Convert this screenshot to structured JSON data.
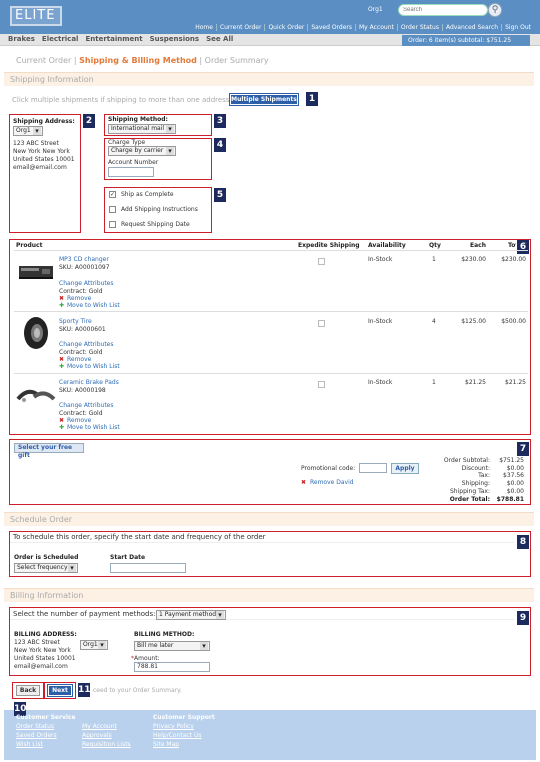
{
  "header": {
    "logo": "ELITE",
    "org": "Org1",
    "search_placeholder": "Search",
    "links": [
      "Home",
      "Current Order",
      "Quick Order",
      "Saved Orders",
      "My Account",
      "Order Status",
      "Advanced Search",
      "Sign Out"
    ],
    "categories": [
      "Brakes",
      "Electrical",
      "Entertainment",
      "Suspensions",
      "See All"
    ],
    "order_summary": "Order: 6 item(s) subtotal: $751.25"
  },
  "steps": [
    "Current Order",
    "Shipping & Billing Method",
    "Order Summary"
  ],
  "shipping": {
    "section_title": "Shipping Information",
    "hint": "Click multiple shipments if shipping to more than one address",
    "multiple_button": "Multiple Shipments",
    "address_label": "Shipping Address:",
    "address_select": "Org1",
    "address_lines": [
      "123 ABC Street",
      "New York New York",
      "United States 10001",
      "email@email.com"
    ],
    "method_label": "Shipping Method:",
    "method_value": "International mail",
    "charge_type_label": "Charge Type",
    "charge_type_value": "Charge by carrier",
    "account_number_label": "Account Number",
    "options": [
      "Ship as Complete",
      "Add Shipping Instructions",
      "Request Shipping Date"
    ]
  },
  "items": {
    "headers": [
      "Product",
      "Expedite Shipping",
      "Availability",
      "Qty",
      "Each",
      "Total"
    ],
    "rows": [
      {
        "name": "MP3 CD changer",
        "sku": "SKU:  A00001097",
        "change": "Change Attributes",
        "contract": "Contract: Gold",
        "remove": "Remove",
        "wish": "Move to Wish List",
        "availability": "In-Stock",
        "qty": "1",
        "each": "$230.00",
        "total": "$230.00"
      },
      {
        "name": "Sporty Tire",
        "sku": "SKU:  A0000601",
        "change": "Change Attributes",
        "contract": "Contract: Gold",
        "remove": "Remove",
        "wish": "Move to Wish List",
        "availability": "In-Stock",
        "qty": "4",
        "each": "$125.00",
        "total": "$500.00"
      },
      {
        "name": "Ceramic Brake Pads",
        "sku": "SKU:  A0000198",
        "change": "Change Attributes",
        "contract": "Contract: Gold",
        "remove": "Remove",
        "wish": "Move to Wish List",
        "availability": "In-Stock",
        "qty": "1",
        "each": "$21.25",
        "total": "$21.25"
      }
    ]
  },
  "totals": {
    "gift_button": "Select your free gift",
    "promo_label": "Promotional code:",
    "apply": "Apply",
    "remove_promo": "Remove David",
    "labels": [
      "Order Subtotal:",
      "Discount:",
      "Tax:",
      "Shipping:",
      "Shipping Tax:",
      "Order Total:"
    ],
    "values": [
      "$751.25",
      "$0.00",
      "$37.56",
      "$0.00",
      "$0.00",
      "$788.81"
    ]
  },
  "schedule": {
    "section_title": "Schedule Order",
    "intro": "To schedule this order, specify the start date and frequency of the order",
    "scheduled_label": "Order is Scheduled",
    "frequency": "Select frequency",
    "start_label": "Start Date"
  },
  "billing": {
    "section_title": "Billing Information",
    "payments_label": "Select the number of payment methods:",
    "payments_value": "1 Payment method(s)",
    "address_label": "BILLING ADDRESS:",
    "address_lines": [
      "123 ABC Street",
      "New York New York",
      "United States 10001",
      "email@email.com"
    ],
    "address_select": "Org1",
    "method_label": "BILLING METHOD:",
    "method_value": "Bill me later",
    "amount_label": "Amount:",
    "amount_value": "788.81"
  },
  "nav": {
    "back": "Back",
    "next": "Next",
    "proceed": "ceed to your Order Summary."
  },
  "footer": {
    "col1_title": "Customer Service",
    "col1": [
      "Order Status",
      "Saved Orders",
      "Wish List"
    ],
    "col2": [
      "My Account",
      "Approvals",
      "Requisition Lists"
    ],
    "col3_title": "Customer Support",
    "col3": [
      "Privacy Policy",
      "Help/Contact Us",
      "Site Map"
    ]
  },
  "tags": [
    "1",
    "2",
    "3",
    "4",
    "5",
    "6",
    "7",
    "8",
    "9",
    "10",
    "11"
  ]
}
